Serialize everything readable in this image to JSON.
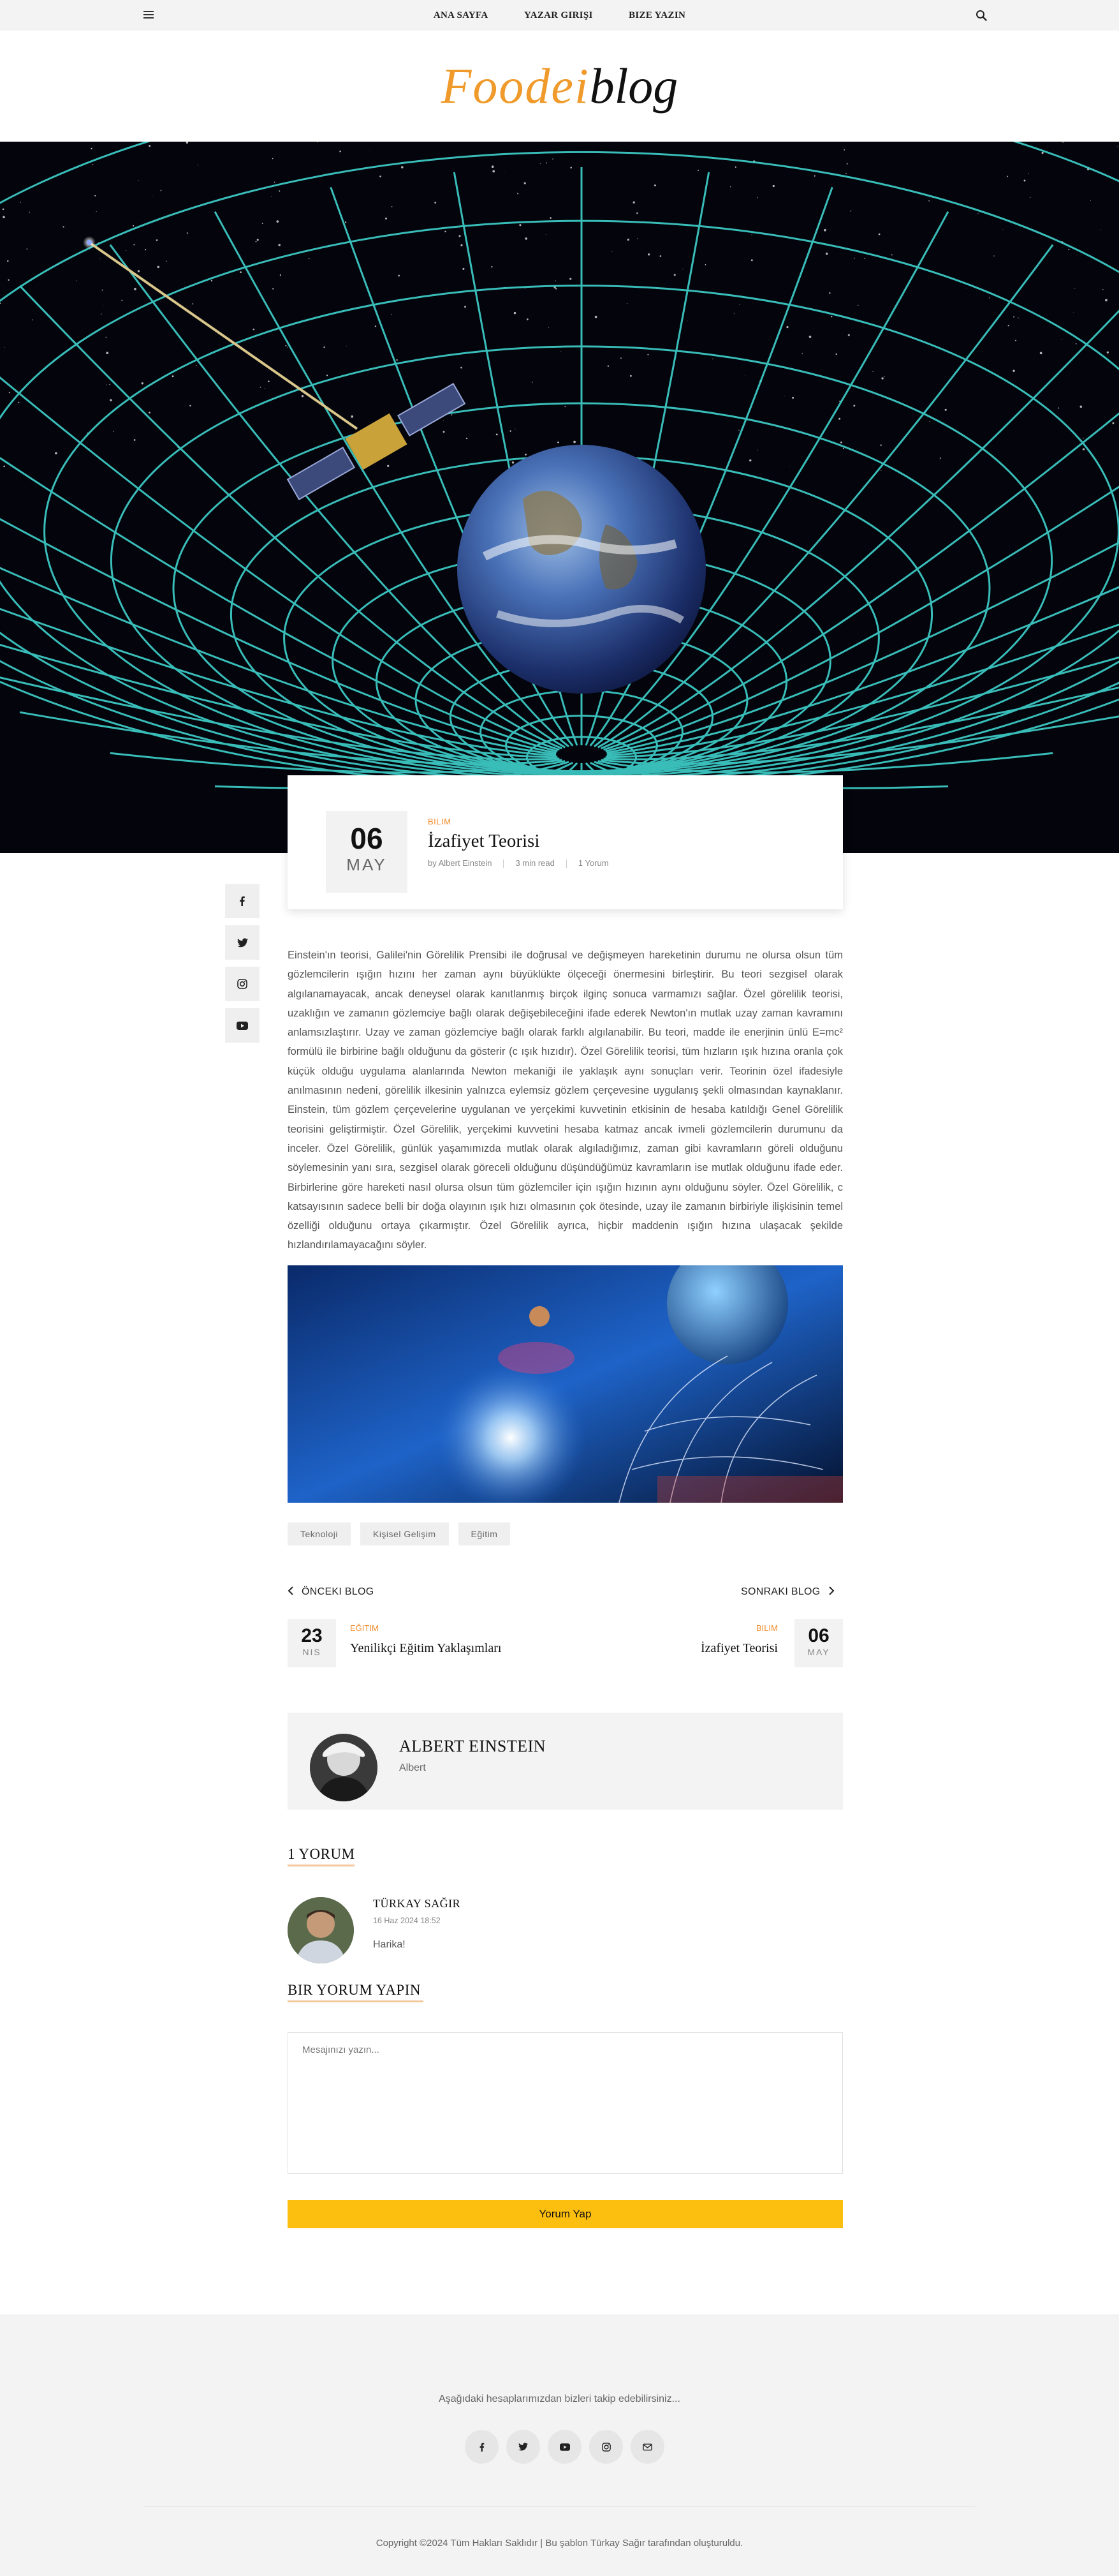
{
  "nav": {
    "items": [
      "ANA SAYFA",
      "YAZAR GIRIŞI",
      "BIZE YAZIN"
    ],
    "menu_icon": "hamburger-icon",
    "search_icon": "search-icon"
  },
  "logo": {
    "part1": "Foodei",
    "part2": "blog"
  },
  "colors": {
    "accent": "#ef8a2a",
    "logo_orange": "#ef9a2a",
    "button_yellow": "#fdbf0f",
    "footer_bg": "#f3f3f3"
  },
  "post": {
    "day": "06",
    "month": "MAY",
    "category": "BILIM",
    "title": "İzafiyet Teorisi",
    "author": "by Albert Einstein",
    "read_time": "3 min read",
    "comments": "1 Yorum"
  },
  "share": [
    "facebook-icon",
    "twitter-icon",
    "instagram-icon",
    "youtube-icon"
  ],
  "article": "Einstein'ın teorisi, Galilei'nin Görelilik Prensibi ile doğrusal ve değişmeyen hareketinin durumu ne olursa olsun tüm gözlemcilerin ışığın hızını her zaman aynı büyüklükte ölçeceği önermesini birleştirir. Bu teori sezgisel olarak algılanamayacak, ancak deneysel olarak kanıtlanmış birçok ilginç sonuca varmamızı sağlar. Özel görelilik teorisi, uzaklığın ve zamanın gözlemciye bağlı olarak değişebileceğini ifade ederek Newton'ın mutlak uzay zaman kavramını anlamsızlaştırır. Uzay ve zaman gözlemciye bağlı olarak farklı algılanabilir. Bu teori, madde ile enerjinin ünlü E=mc² formülü ile birbirine bağlı olduğunu da gösterir (c ışık hızıdır). Özel Görelilik teorisi, tüm hızların ışık hızına oranla çok küçük olduğu uygulama alanlarında Newton mekaniği ile yaklaşık aynı sonuçları verir. Teorinin özel ifadesiyle anılmasının nedeni, görelilik ilkesinin yalnızca eylemsiz gözlem çerçevesine uygulanış şekli olmasından kaynaklanır. Einstein, tüm gözlem çerçevelerine uygulanan ve yerçekimi kuvvetinin etkisinin de hesaba katıldığı Genel Görelilik teorisini geliştirmiştir. Özel Görelilik, yerçekimi kuvvetini hesaba katmaz ancak ivmeli gözlemcilerin durumunu da inceler. Özel Görelilik, günlük yaşamımızda mutlak olarak algıladığımız, zaman gibi kavramların göreli olduğunu söylemesinin yanı sıra, sezgisel olarak göreceli olduğunu düşündüğümüz kavramların ise mutlak olduğunu ifade eder. Birbirlerine göre hareketi nasıl olursa olsun tüm gözlemciler için ışığın hızının aynı olduğunu söyler. Özel Görelilik, c katsayısının sadece belli bir doğa olayının ışık hızı olmasının çok ötesinde, uzay ile zamanın birbiriyle ilişkisinin temel özelliği olduğunu ortaya çıkarmıştır. Özel Görelilik ayrıca, hiçbir maddenin ışığın hızına ulaşacak şekilde hızlandırılamayacağını söyler.",
  "tags": [
    "Teknoloji",
    "Kişisel Gelişim",
    "Eğitim"
  ],
  "prev": {
    "label": "ÖNCEKI BLOG",
    "day": "23",
    "month": "NIS",
    "category": "EĞITIM",
    "title": "Yenilikçi Eğitim Yaklaşımları"
  },
  "next": {
    "label": "SONRAKI BLOG",
    "day": "06",
    "month": "MAY",
    "category": "BILIM",
    "title": "İzafiyet Teorisi"
  },
  "author_box": {
    "name": "ALBERT EINSTEIN",
    "sub": "Albert"
  },
  "comments": {
    "heading": "1 YORUM",
    "items": [
      {
        "name": "TÜRKAY SAĞIR",
        "date": "16 Haz 2024 18:52",
        "text": "Harika!"
      }
    ]
  },
  "comment_form": {
    "heading": "BIR YORUM YAPIN",
    "placeholder": "Mesajınızı yazın...",
    "submit": "Yorum Yap"
  },
  "footer": {
    "text": "Aşağıdaki hesaplarımızdan bizleri takip edebilirsiniz...",
    "social": [
      "facebook-icon",
      "twitter-icon",
      "youtube-icon",
      "instagram-icon",
      "mail-icon"
    ],
    "copyright": "Copyright ©2024 Tüm Hakları Saklıdır | Bu şablon Türkay Sağır tarafından oluşturuldu."
  }
}
